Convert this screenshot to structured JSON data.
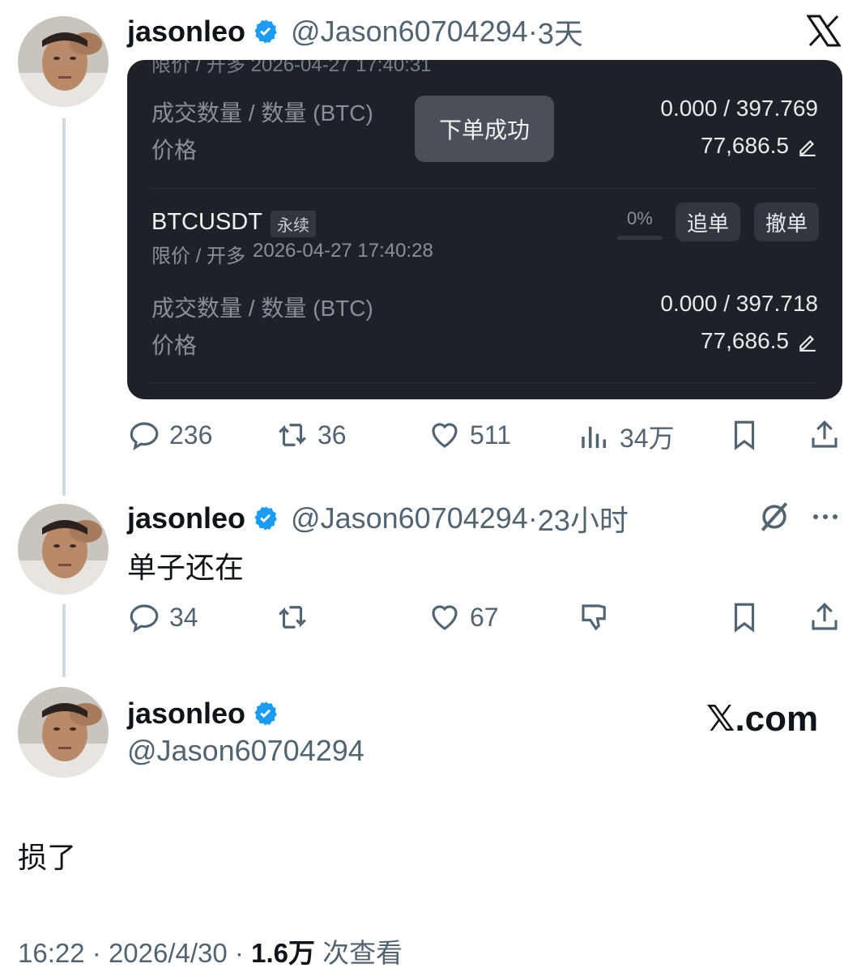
{
  "tweet1": {
    "name": "jasonleo",
    "handle": "@Jason60704294",
    "time": "3天",
    "card": {
      "header_partial": "限价 / 开多  2026-04-27 17:40:31",
      "order1": {
        "qty_label": "成交数量 / 数量 (BTC)",
        "qty_value": "0.000 / 397.769",
        "price_label": "价格",
        "price_value": "77,686.5"
      },
      "toast": "下单成功",
      "order2": {
        "symbol": "BTCUSDT",
        "tag": "永续",
        "side": "限价 / 开多",
        "datetime": "2026-04-27 17:40:28",
        "progress": "0%",
        "progress_fraction": 0,
        "btn_chase": "追单",
        "btn_cancel": "撤单",
        "qty_label": "成交数量 / 数量 (BTC)",
        "qty_value": "0.000 / 397.718",
        "price_label": "价格",
        "price_value": "77,686.5"
      }
    },
    "actions": {
      "replies": "236",
      "retweets": "36",
      "likes": "511",
      "views": "34万"
    }
  },
  "tweet2": {
    "name": "jasonleo",
    "handle": "@Jason60704294",
    "time": "23小时",
    "text": "单子还在",
    "actions": {
      "replies": "34",
      "retweets": "",
      "likes": "67"
    }
  },
  "tweet3": {
    "name": "jasonleo",
    "handle": "@Jason60704294",
    "brand": "𝕏.com",
    "text": "损了",
    "time": "16:22",
    "date": "2026/4/30",
    "views": "1.6万",
    "views_label": "次查看"
  },
  "colors": {
    "verified": "#1d9bf0",
    "card_bg": "#1e2128",
    "green": "#2ebd85",
    "muted": "#536471"
  }
}
